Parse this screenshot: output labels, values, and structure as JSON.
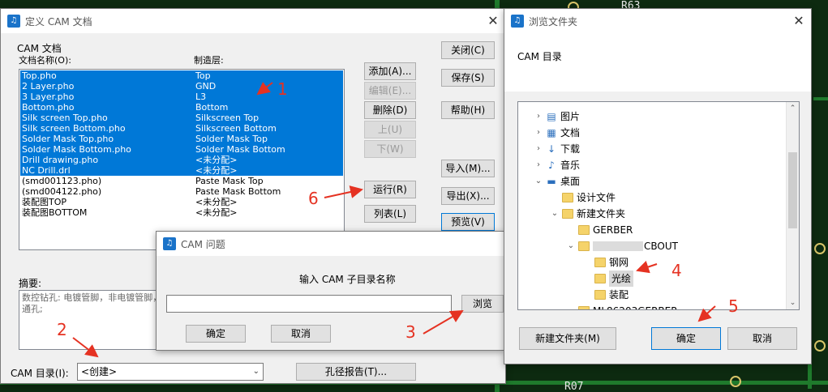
{
  "background": {
    "silk_label": "R63",
    "silk_bottom": "R07"
  },
  "cam_dialog": {
    "title": "定义 CAM 文档",
    "group_label": "CAM 文档",
    "col_name": "文档名称(O):",
    "col_layer": "制造层:",
    "files": [
      {
        "name": "Top.pho",
        "layer": "Top",
        "selected": true
      },
      {
        "name": "2 Layer.pho",
        "layer": "GND",
        "selected": true
      },
      {
        "name": "3 Layer.pho",
        "layer": "L3",
        "selected": true
      },
      {
        "name": "Bottom.pho",
        "layer": "Bottom",
        "selected": true
      },
      {
        "name": "Silk screen Top.pho",
        "layer": "Silkscreen Top",
        "selected": true
      },
      {
        "name": "Silk screen Bottom.pho",
        "layer": "Silkscreen Bottom",
        "selected": true
      },
      {
        "name": "Solder Mask Top.pho",
        "layer": "Solder Mask Top",
        "selected": true
      },
      {
        "name": "Solder Mask Bottom.pho",
        "layer": "Solder Mask Bottom",
        "selected": true
      },
      {
        "name": "Drill drawing.pho",
        "layer": "<未分配>",
        "selected": true
      },
      {
        "name": "NC Drill.drl",
        "layer": "<未分配>",
        "selected": true
      },
      {
        "name": "(smd001123.pho)",
        "layer": "Paste Mask Top",
        "selected": false
      },
      {
        "name": "(smd004122.pho)",
        "layer": "Paste Mask Bottom",
        "selected": false
      },
      {
        "name": "装配图TOP",
        "layer": "<未分配>",
        "selected": false
      },
      {
        "name": "装配图BOTTOM",
        "layer": "<未分配>",
        "selected": false
      }
    ],
    "buttons": {
      "add": "添加(A)...",
      "edit": "编辑(E)...",
      "delete": "删除(D)",
      "up": "上(U)",
      "down": "下(W)",
      "run": "运行(R)",
      "list": "列表(L)",
      "close": "关闭(C)",
      "save": "保存(S)",
      "help": "帮助(H)",
      "import": "导入(M)...",
      "export": "导出(X)...",
      "preview": "预览(V)",
      "drill_report": "孔径报告(T)..."
    },
    "summary_label": "摘要:",
    "summary_text": "数控钻孔: 电镀管脚，非电镀管脚，电镀通孔，",
    "summary_text2": "通孔;",
    "cam_dir_label": "CAM 目录(I):",
    "cam_dir_value": "<创建>"
  },
  "question_dialog": {
    "title": "CAM 问题",
    "prompt": "输入 CAM 子目录名称",
    "input_value": "",
    "browse": "浏览",
    "ok": "确定",
    "cancel": "取消"
  },
  "browse_dialog": {
    "title": "浏览文件夹",
    "heading": "CAM 目录",
    "tree": [
      {
        "label": "图片",
        "icon": "pictures-icon",
        "glyph": "▤",
        "indent": 0,
        "chev": "›"
      },
      {
        "label": "文档",
        "icon": "documents-icon",
        "glyph": "▦",
        "indent": 0,
        "chev": "›"
      },
      {
        "label": "下载",
        "icon": "download-icon",
        "glyph": "↓",
        "indent": 0,
        "chev": "›"
      },
      {
        "label": "音乐",
        "icon": "music-icon",
        "glyph": "♪",
        "indent": 0,
        "chev": "›"
      },
      {
        "label": "桌面",
        "icon": "desktop-icon",
        "glyph": "▬",
        "indent": 0,
        "chev": "⌄"
      },
      {
        "label": "设计文件",
        "icon": "folder-icon",
        "glyph": "",
        "indent": 1,
        "chev": ""
      },
      {
        "label": "新建文件夹",
        "icon": "folder-icon",
        "glyph": "",
        "indent": 1,
        "chev": "⌄"
      },
      {
        "label": "GERBER",
        "icon": "folder-icon",
        "glyph": "",
        "indent": 2,
        "chev": ""
      },
      {
        "label": "CBOUT",
        "icon": "folder-icon",
        "glyph": "",
        "indent": 2,
        "chev": "⌄"
      },
      {
        "label": "钢网",
        "icon": "folder-icon",
        "glyph": "",
        "indent": 3,
        "chev": ""
      },
      {
        "label": "光绘",
        "icon": "folder-icon",
        "glyph": "",
        "indent": 3,
        "chev": "",
        "selected": true
      },
      {
        "label": "装配",
        "icon": "folder-icon",
        "glyph": "",
        "indent": 3,
        "chev": ""
      },
      {
        "label": "ML86203GERBER",
        "icon": "folder-icon",
        "glyph": "",
        "indent": 2,
        "chev": ""
      }
    ],
    "new_folder": "新建文件夹(M)",
    "ok": "确定",
    "cancel": "取消"
  },
  "annotations": [
    "1",
    "2",
    "3",
    "4",
    "5",
    "6"
  ],
  "colors": {
    "selection": "#0078d7",
    "annotation": "#e53222"
  }
}
